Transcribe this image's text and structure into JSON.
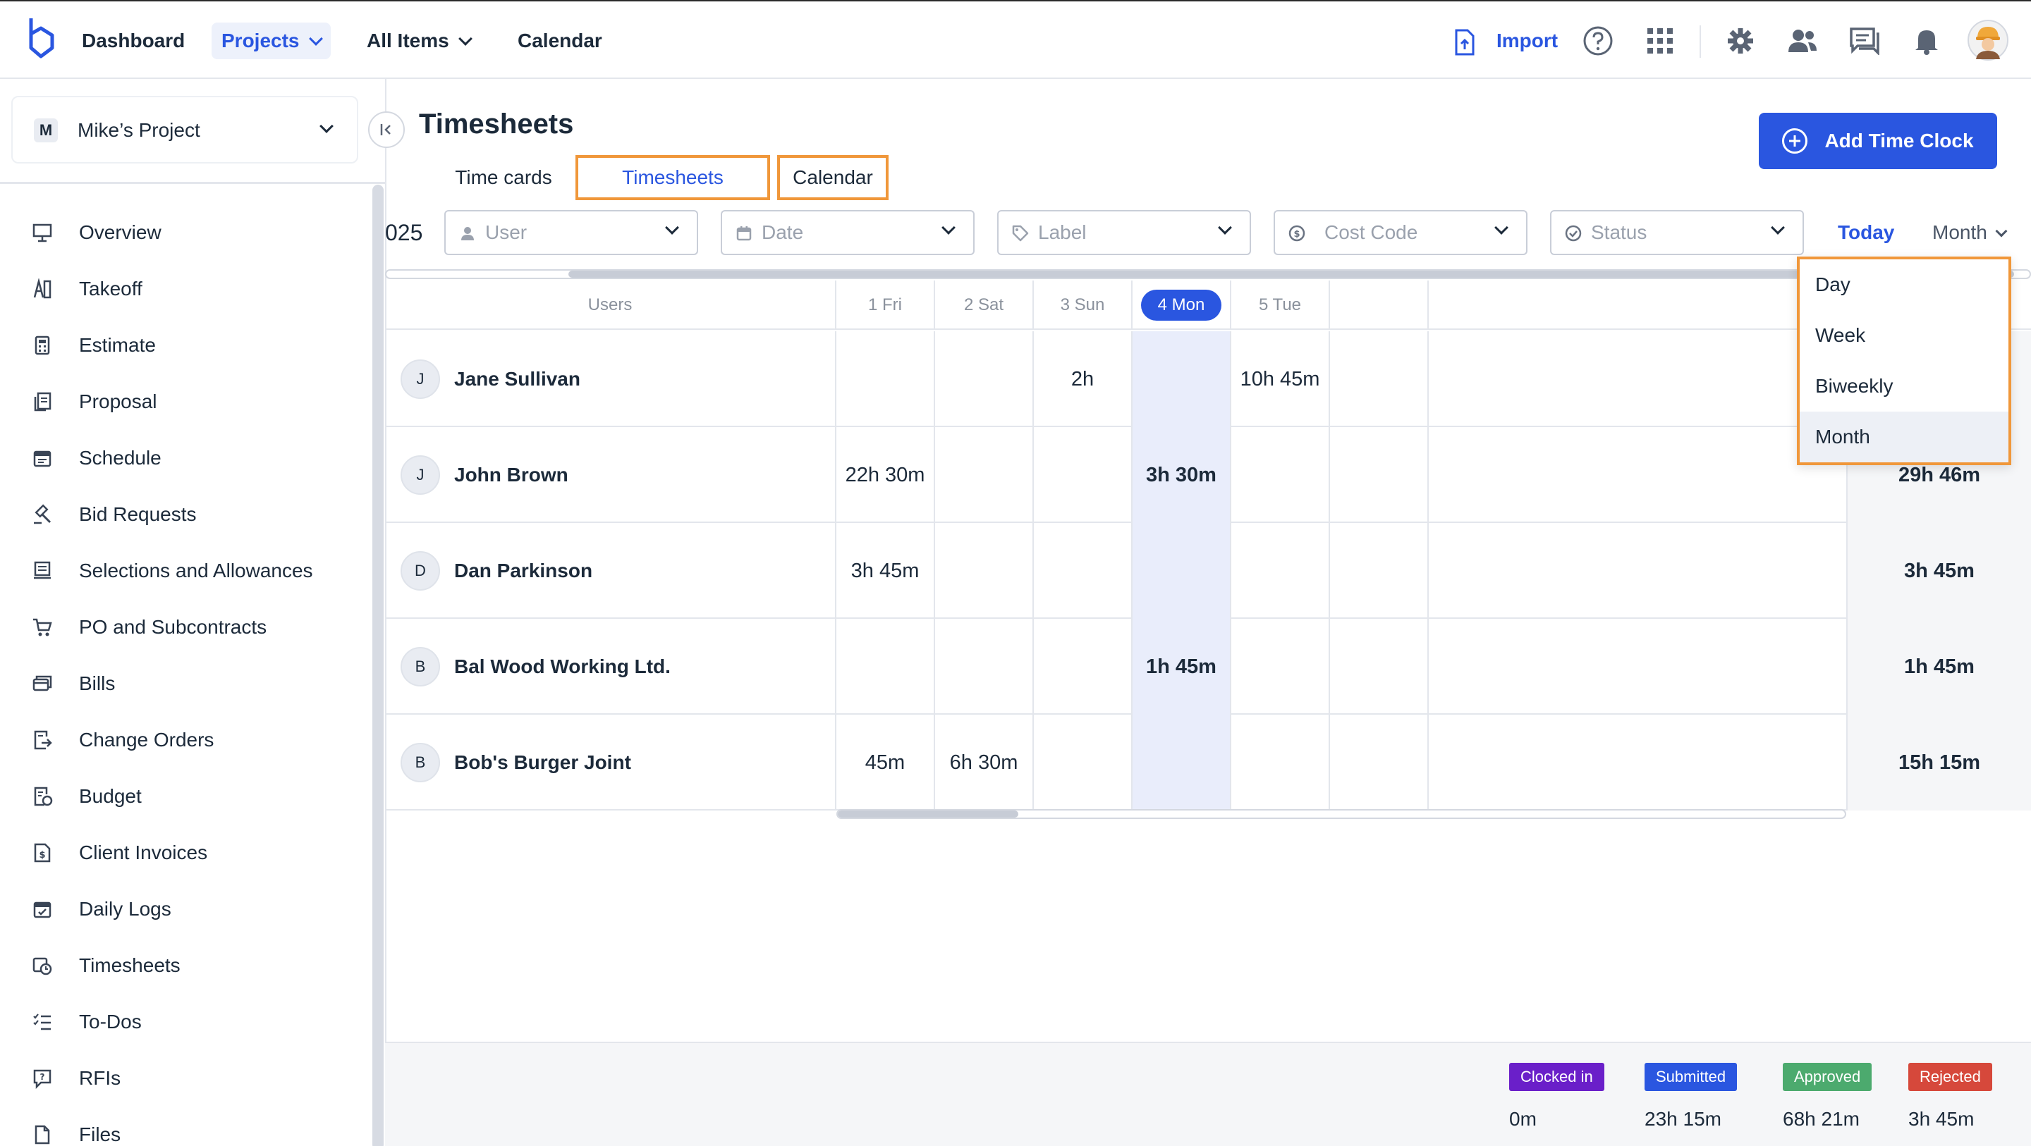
{
  "nav": {
    "dashboard": "Dashboard",
    "projects": "Projects",
    "all_items": "All Items",
    "calendar": "Calendar",
    "import": "Import"
  },
  "sidebar": {
    "project_initial": "M",
    "project_name": "Mike’s Project",
    "items": [
      {
        "label": "Overview",
        "icon": "overview-icon"
      },
      {
        "label": "Takeoff",
        "icon": "takeoff-icon"
      },
      {
        "label": "Estimate",
        "icon": "calculator-icon"
      },
      {
        "label": "Proposal",
        "icon": "proposal-icon"
      },
      {
        "label": "Schedule",
        "icon": "schedule-icon"
      },
      {
        "label": "Bid Requests",
        "icon": "gavel-icon"
      },
      {
        "label": "Selections and Allowances",
        "icon": "selections-icon"
      },
      {
        "label": "PO and Subcontracts",
        "icon": "cart-icon"
      },
      {
        "label": "Bills",
        "icon": "bills-icon"
      },
      {
        "label": "Change Orders",
        "icon": "change-orders-icon"
      },
      {
        "label": "Budget",
        "icon": "budget-icon"
      },
      {
        "label": "Client Invoices",
        "icon": "invoice-icon"
      },
      {
        "label": "Daily Logs",
        "icon": "daily-logs-icon"
      },
      {
        "label": "Timesheets",
        "icon": "timesheets-icon"
      },
      {
        "label": "To-Dos",
        "icon": "todo-icon"
      },
      {
        "label": "RFIs",
        "icon": "rfi-icon"
      },
      {
        "label": "Files",
        "icon": "files-icon"
      }
    ]
  },
  "page": {
    "title": "Timesheets",
    "add_button": "Add Time Clock",
    "tabs": [
      "Time cards",
      "Timesheets",
      "Calendar"
    ],
    "year_fragment": "025"
  },
  "filters": {
    "user": "User",
    "date": "Date",
    "label": "Label",
    "cost_code": "Cost Code",
    "status": "Status",
    "today": "Today",
    "view": "Month"
  },
  "view_options": [
    "Day",
    "Week",
    "Biweekly",
    "Month"
  ],
  "table": {
    "users_header": "Users",
    "days": [
      "1 Fri",
      "2 Sat",
      "3 Sun",
      "4 Mon",
      "5 Tue"
    ],
    "rows": [
      {
        "initial": "J",
        "name": "Jane Sullivan",
        "cells": [
          "",
          "",
          "2h",
          "",
          "10h 45m"
        ],
        "total": ""
      },
      {
        "initial": "J",
        "name": "John Brown",
        "cells": [
          "22h 30m",
          "",
          "",
          "3h 30m",
          ""
        ],
        "total": "29h 46m"
      },
      {
        "initial": "D",
        "name": "Dan Parkinson",
        "cells": [
          "3h 45m",
          "",
          "",
          "",
          ""
        ],
        "total": "3h 45m"
      },
      {
        "initial": "B",
        "name": "Bal Wood Working Ltd.",
        "cells": [
          "",
          "",
          "",
          "1h 45m",
          ""
        ],
        "total": "1h 45m"
      },
      {
        "initial": "B",
        "name": "Bob's Burger Joint",
        "cells": [
          "45m",
          "6h 30m",
          "",
          "",
          ""
        ],
        "total": "15h 15m"
      }
    ]
  },
  "legend": [
    {
      "label": "Clocked in",
      "value": "0m",
      "color": "#6a1fc9"
    },
    {
      "label": "Submitted",
      "value": "23h 15m",
      "color": "#2a56e0"
    },
    {
      "label": "Approved",
      "value": "68h 21m",
      "color": "#4caa6e"
    },
    {
      "label": "Rejected",
      "value": "3h 45m",
      "color": "#d6483b"
    }
  ]
}
